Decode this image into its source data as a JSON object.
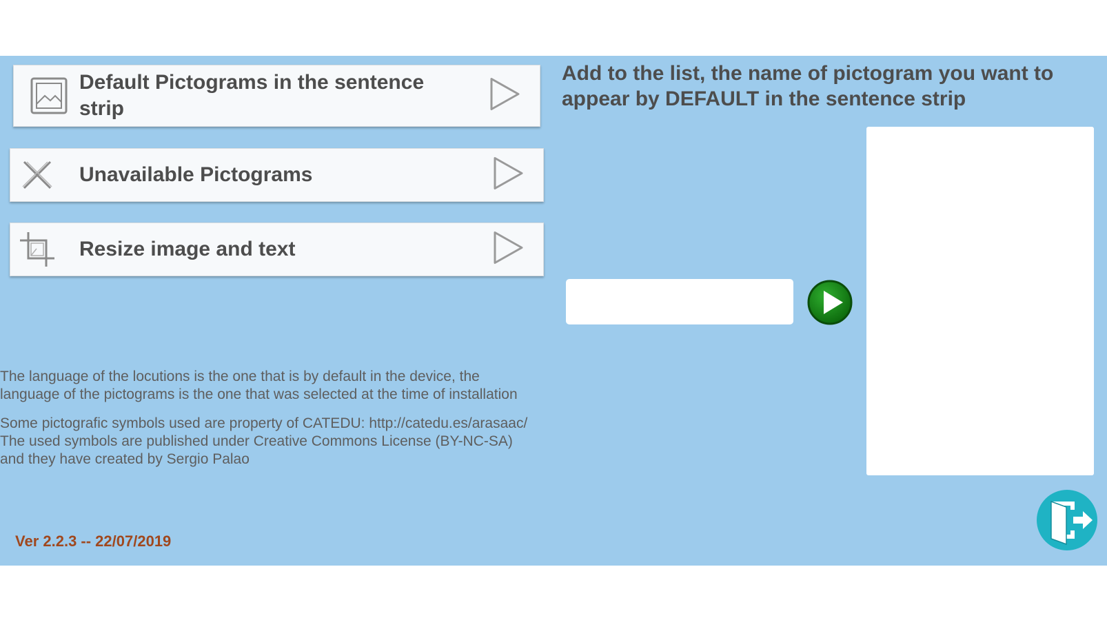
{
  "menu": {
    "default_pictograms": "Default Pictograms in the sentence strip",
    "unavailable_pictograms": "Unavailable Pictograms",
    "resize": "Resize image and text"
  },
  "instruction": "Add to the list, the name of pictogram you want to appear by DEFAULT in the sentence strip",
  "name_input": {
    "value": "",
    "placeholder": ""
  },
  "info": {
    "language": "The language of the locutions is the one that is by default in the device, the language of the pictograms is the one that was selected at the time of installation",
    "credits": "Some pictografic symbols used are property of CATEDU: http://catedu.es/arasaac/ The used symbols are published under Creative Commons License (BY-NC-SA) and they have created by Sergio Palao"
  },
  "version": "Ver 2.2.3 -- 22/07/2019",
  "icons": {
    "default": "image-icon",
    "unavailable": "cross-icon",
    "resize": "crop-icon",
    "arrow": "play-outline-icon",
    "add": "green-play-icon",
    "exit": "exit-door-icon"
  },
  "colors": {
    "background": "#9dcbec",
    "text": "#4d4d4d",
    "version": "#a0481e",
    "add_button": "#1a8a1a",
    "exit_button": "#1fb3c4"
  }
}
